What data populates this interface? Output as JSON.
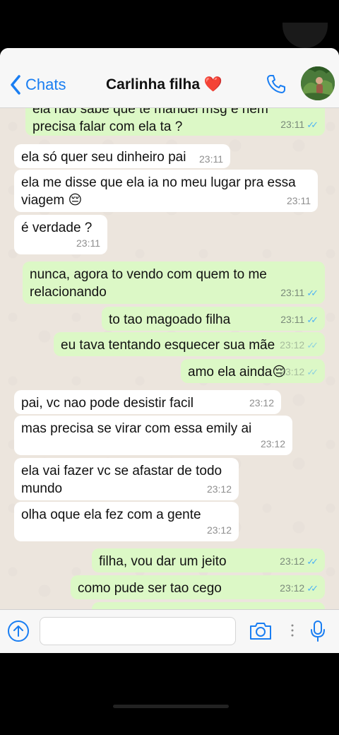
{
  "header": {
    "back_label": "Chats",
    "contact_name": "Carlinha filha",
    "heart": "❤️"
  },
  "messages": [
    {
      "dir": "out",
      "text": "ela nao sabe que te mandei msg e nem precisa falar com ela ta ?",
      "time": "23:11",
      "read": true
    },
    {
      "dir": "in",
      "text": "ela só quer seu dinheiro pai",
      "time": "23:11"
    },
    {
      "dir": "in",
      "text": "ela me disse que ela ia no meu lugar pra essa viagem 😔",
      "time": "23:11"
    },
    {
      "dir": "in",
      "text": "é verdade ?",
      "time": "23:11"
    },
    {
      "dir": "out",
      "text": "nunca, agora to vendo com quem to me relacionando",
      "time": "23:11",
      "read": true
    },
    {
      "dir": "out",
      "text": "to tao magoado filha",
      "time": "23:11",
      "read": true
    },
    {
      "dir": "out",
      "text": "eu tava tentando esquecer sua mãe",
      "time": "23:12",
      "read": true
    },
    {
      "dir": "out",
      "text": "amo ela ainda😔",
      "time": "23:12",
      "read": true
    },
    {
      "dir": "in",
      "text": "pai, vc nao pode desistir facil",
      "time": "23:12"
    },
    {
      "dir": "in",
      "text": "mas precisa se virar com essa emily ai",
      "time": "23:12"
    },
    {
      "dir": "in",
      "text": "ela vai fazer vc se afastar de todo mundo",
      "time": "23:12"
    },
    {
      "dir": "in",
      "text": "olha oque ela fez com a gente",
      "time": "23:12"
    },
    {
      "dir": "out",
      "text": "filha, vou dar um jeito",
      "time": "23:12",
      "read": true
    },
    {
      "dir": "out",
      "text": "como pude ser tao cego",
      "time": "23:12",
      "read": true
    }
  ],
  "icons": {
    "back": "chevron-left-icon",
    "call": "phone-icon",
    "attach": "upload-icon",
    "camera": "camera-icon",
    "mic": "microphone-icon"
  },
  "colors": {
    "accent": "#1a7ef2",
    "outgoing_bubble": "#dcf8c6",
    "incoming_bubble": "#ffffff",
    "chat_bg": "#ece5dd",
    "read_ticks": "#4fb3f4"
  }
}
